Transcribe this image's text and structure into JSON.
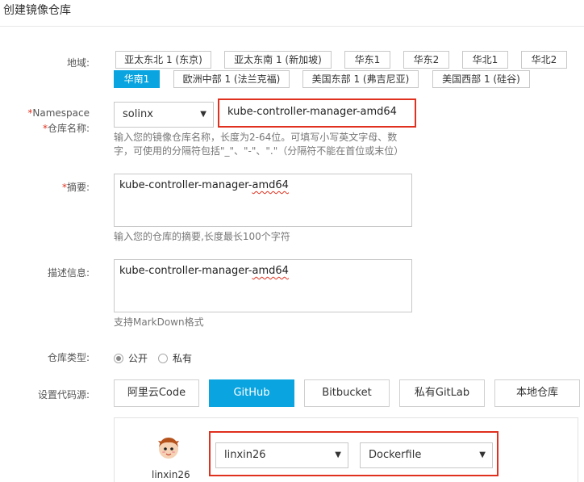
{
  "page": {
    "title": "创建镜像仓库"
  },
  "region": {
    "label": "地域:",
    "buttons": [
      "亚太东北 1 (东京)",
      "亚太东南 1 (新加坡)",
      "华东1",
      "华东2",
      "华北1",
      "华北2",
      "华南1",
      "欧洲中部 1 (法兰克福)",
      "美国东部 1 (弗吉尼亚)",
      "美国西部 1 (硅谷)"
    ],
    "selected": "华南1"
  },
  "namespace": {
    "label_required": "*",
    "label": "Namespace",
    "repo_label_required": "*",
    "repo_label": "仓库名称:",
    "selected": "solinx",
    "caret": "▼",
    "repo_name": "kube-controller-manager-amd64",
    "hint_line1": "输入您的镜像仓库名称，长度为2-64位。可填写小写英文字母、数",
    "hint_line2": "字，可使用的分隔符包括\"_\"、\"-\"、\".\"（分隔符不能在首位或末位）"
  },
  "summary": {
    "label_required": "*",
    "label": "摘要:",
    "value_prefix": "kube-controller-manager-",
    "value_suffix": "amd64",
    "hint": "输入您的仓库的摘要,长度最长100个字符"
  },
  "description": {
    "label": "描述信息:",
    "value_prefix": "kube-controller-manager-",
    "value_suffix": "amd64",
    "hint": "支持MarkDown格式"
  },
  "repo_type": {
    "label": "仓库类型:",
    "options": [
      "公开",
      "私有"
    ],
    "selected": "公开"
  },
  "code_source": {
    "label": "设置代码源:",
    "buttons": [
      "阿里云Code",
      "GitHub",
      "Bitbucket",
      "私有GitLab",
      "本地仓库"
    ],
    "selected": "GitHub"
  },
  "github": {
    "username": "linxin26",
    "account_select": "linxin26",
    "repo_select": "Dockerfile",
    "caret": "▼"
  },
  "colors": {
    "accent": "#0aa5e0",
    "required": "#e0301e",
    "highlight_box": "#e0301e"
  }
}
